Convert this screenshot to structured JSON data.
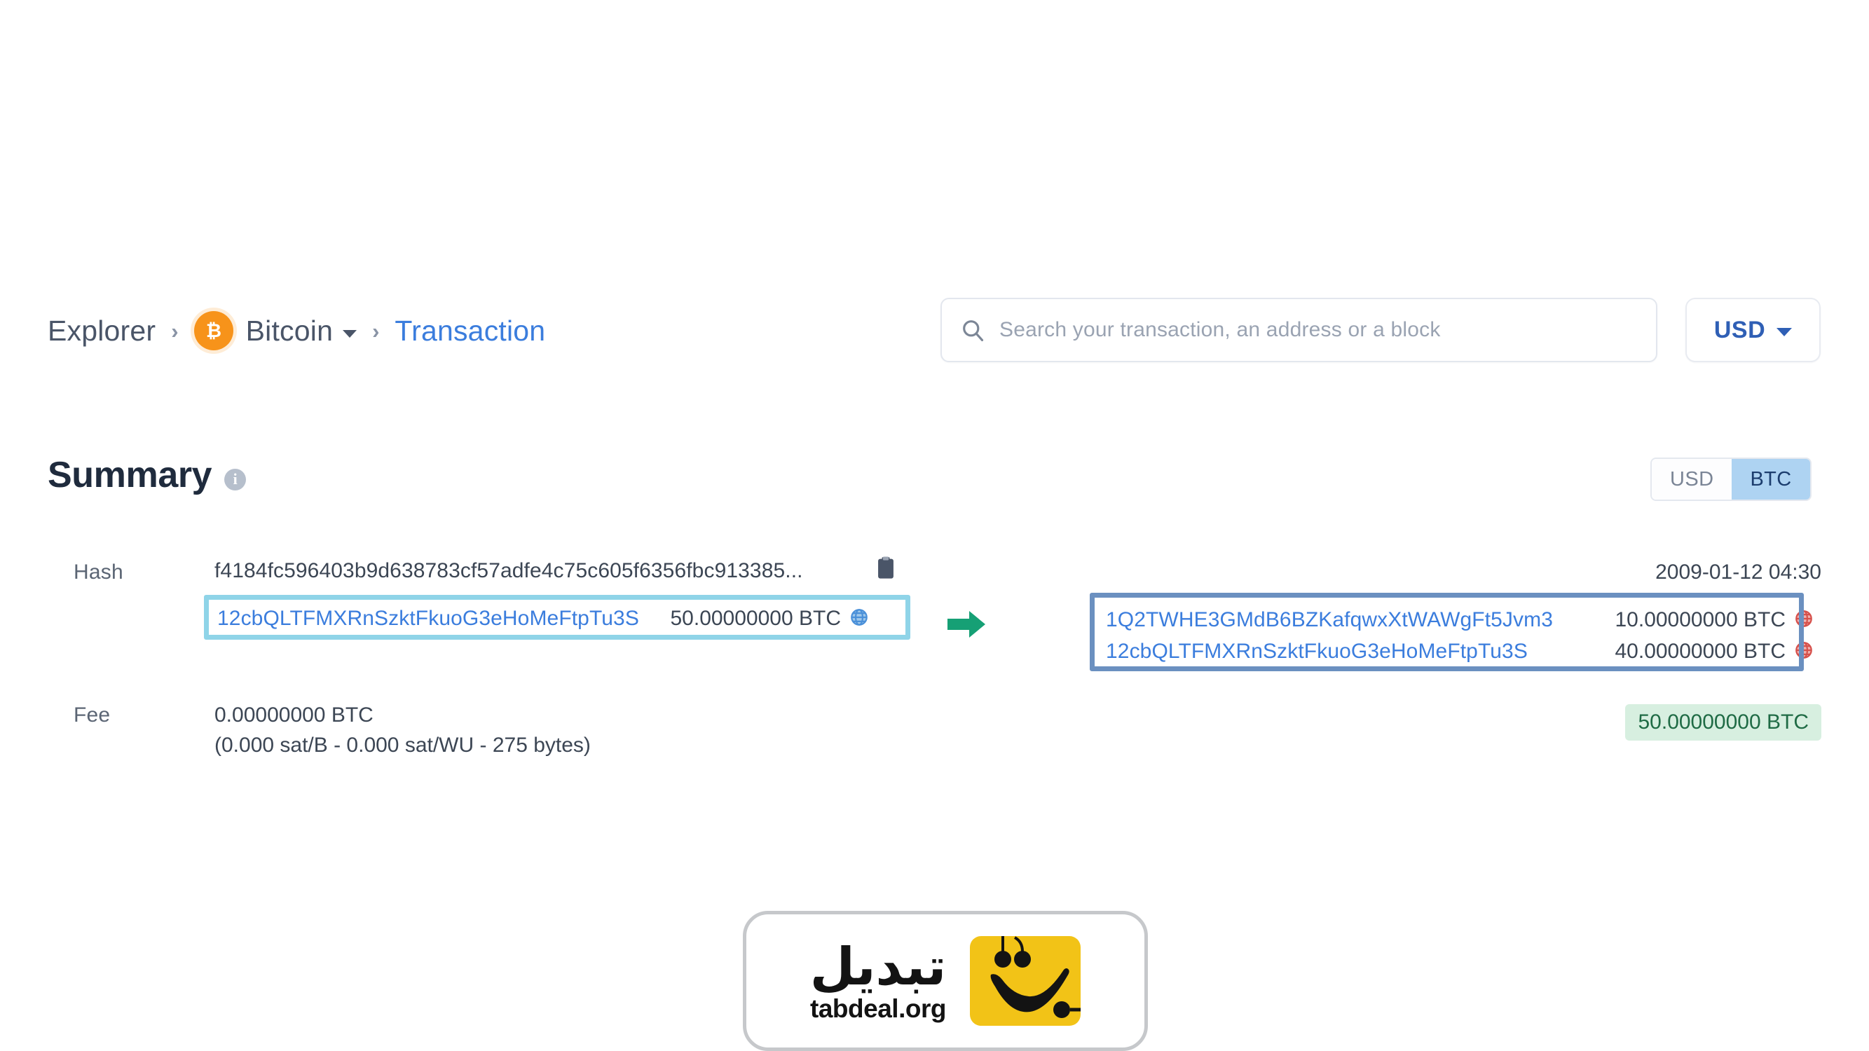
{
  "header": {
    "breadcrumb": [
      {
        "label": "Explorer",
        "type": "text"
      },
      {
        "label": "Bitcoin",
        "type": "coin-dropdown"
      },
      {
        "label": "Transaction",
        "type": "link"
      }
    ],
    "separator": "›",
    "coin_icon": "bitcoin-coin-icon",
    "coin_symbol": "₿"
  },
  "search": {
    "placeholder": "Search your transaction, an address or a block",
    "value": "",
    "icon": "search-icon"
  },
  "currency_selector": {
    "value": "USD",
    "icon": "chevron-down-icon"
  },
  "summary": {
    "title": "Summary",
    "info_icon": "info-icon",
    "info_glyph": "i",
    "unit_toggle": {
      "options": [
        "USD",
        "BTC"
      ],
      "selected": "BTC"
    },
    "rows": {
      "hash_label": "Hash",
      "hash_value": "f4184fc596403b9d638783cf57adfe4c75c605f6356fbc913385...",
      "copy_icon": "copy-icon",
      "timestamp": "2009-01-12 04:30",
      "fee_label": "Fee",
      "fee_value": "0.00000000 BTC",
      "fee_detail": "(0.000 sat/B - 0.000 sat/WU - 275 bytes)",
      "total_badge": "50.00000000 BTC"
    },
    "inputs": [
      {
        "address": "12cbQLTFMXRnSzktFkuoG3eHoMeFtpTu3S",
        "amount": "50.00000000 BTC",
        "globe_icon": "globe-icon",
        "globe_color": "#4a90d9"
      }
    ],
    "outputs": [
      {
        "address": "1Q2TWHE3GMdB6BZKafqwxXtWAWgFt5Jvm3",
        "amount": "10.00000000 BTC",
        "globe_icon": "globe-icon",
        "globe_color": "#e0544f"
      },
      {
        "address": "12cbQLTFMXRnSzktFkuoG3eHoMeFtpTu3S",
        "amount": "40.00000000 BTC",
        "globe_icon": "globe-icon",
        "globe_color": "#e0544f"
      }
    ],
    "flow_arrow_icon": "arrow-right-icon"
  },
  "annotations": [
    {
      "name": "input-highlight-box",
      "color": "#8fd4e8"
    },
    {
      "name": "output-highlight-box",
      "color": "#6b90c0"
    }
  ],
  "watermark": {
    "text_fa": "تبدیل",
    "text_en": "tabdeal.org",
    "logo_icon": "tabdeal-smiley-logo",
    "logo_color": "#f2c317"
  },
  "colors": {
    "link": "#3b7ddd",
    "bitcoin_orange": "#f7931a",
    "accent_blue": "#2f5fb5",
    "success_green": "#1f6b45",
    "success_bg": "#d7efe0",
    "arrow_green": "#16a075"
  }
}
